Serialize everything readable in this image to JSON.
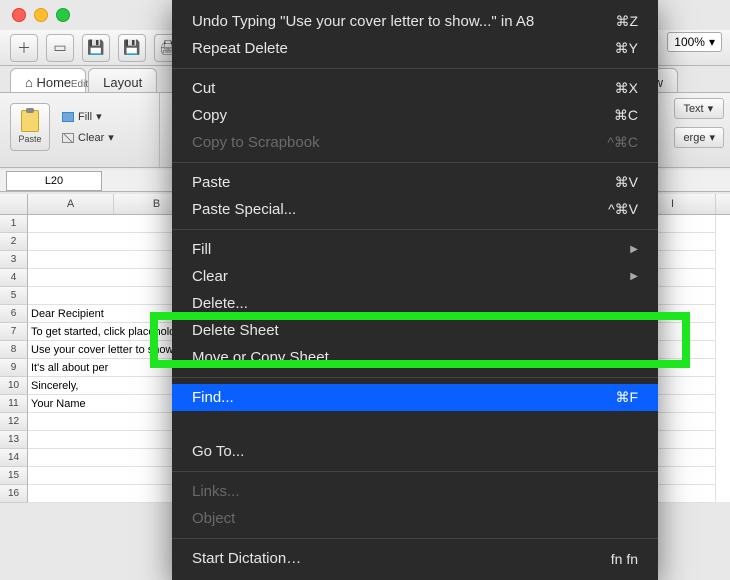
{
  "window_controls": {
    "close": "close",
    "min": "minimize",
    "max": "maximize"
  },
  "toolbar": {
    "zoom": "100%"
  },
  "tabs": {
    "home": "Home",
    "layout": "Layout",
    "right_partial": "w"
  },
  "ribbon": {
    "edit_group": "Edit",
    "paste": "Paste",
    "fill": "Fill",
    "clear": "Clear",
    "text": "Text",
    "merge": "erge"
  },
  "name_box": "L20",
  "columns": [
    "A",
    "B",
    "",
    "",
    "",
    "",
    "",
    "I"
  ],
  "rows": [
    {
      "n": "1",
      "a": ""
    },
    {
      "n": "2",
      "a": ""
    },
    {
      "n": "3",
      "a": ""
    },
    {
      "n": "4",
      "a": ""
    },
    {
      "n": "5",
      "a": ""
    },
    {
      "n": "6",
      "a": "Dear Recipient"
    },
    {
      "n": "7",
      "a": "To get started, click placeholder text and start typing. Use this cover letter to show off your contact in"
    },
    {
      "n": "8",
      "a": "Use your cover letter to show off your skills, talk about your experience, and make sure ero"
    },
    {
      "n": "9",
      "a": "It's all about per"
    },
    {
      "n": "10",
      "a": "Sincerely,"
    },
    {
      "n": "11",
      "a": "Your Name"
    },
    {
      "n": "12",
      "a": ""
    },
    {
      "n": "13",
      "a": ""
    },
    {
      "n": "14",
      "a": ""
    },
    {
      "n": "15",
      "a": ""
    },
    {
      "n": "16",
      "a": ""
    }
  ],
  "menu": {
    "undo": "Undo Typing \"Use your cover letter to show...\" in A8",
    "undo_sc": "⌘Z",
    "repeat": "Repeat Delete",
    "repeat_sc": "⌘Y",
    "cut": "Cut",
    "cut_sc": "⌘X",
    "copy": "Copy",
    "copy_sc": "⌘C",
    "scrapbook": "Copy to Scrapbook",
    "scrapbook_sc": "^⌘C",
    "paste": "Paste",
    "paste_sc": "⌘V",
    "paste_special": "Paste Special...",
    "paste_special_sc": "^⌘V",
    "fill": "Fill",
    "clear": "Clear",
    "delete": "Delete...",
    "delete_sheet": "Delete Sheet",
    "move_copy": "Move or Copy Sheet...",
    "find": "Find...",
    "find_sc": "⌘F",
    "goto": "Go To...",
    "links": "Links...",
    "object": "Object",
    "dictation": "Start Dictation…",
    "dictation_sc": "fn fn"
  }
}
